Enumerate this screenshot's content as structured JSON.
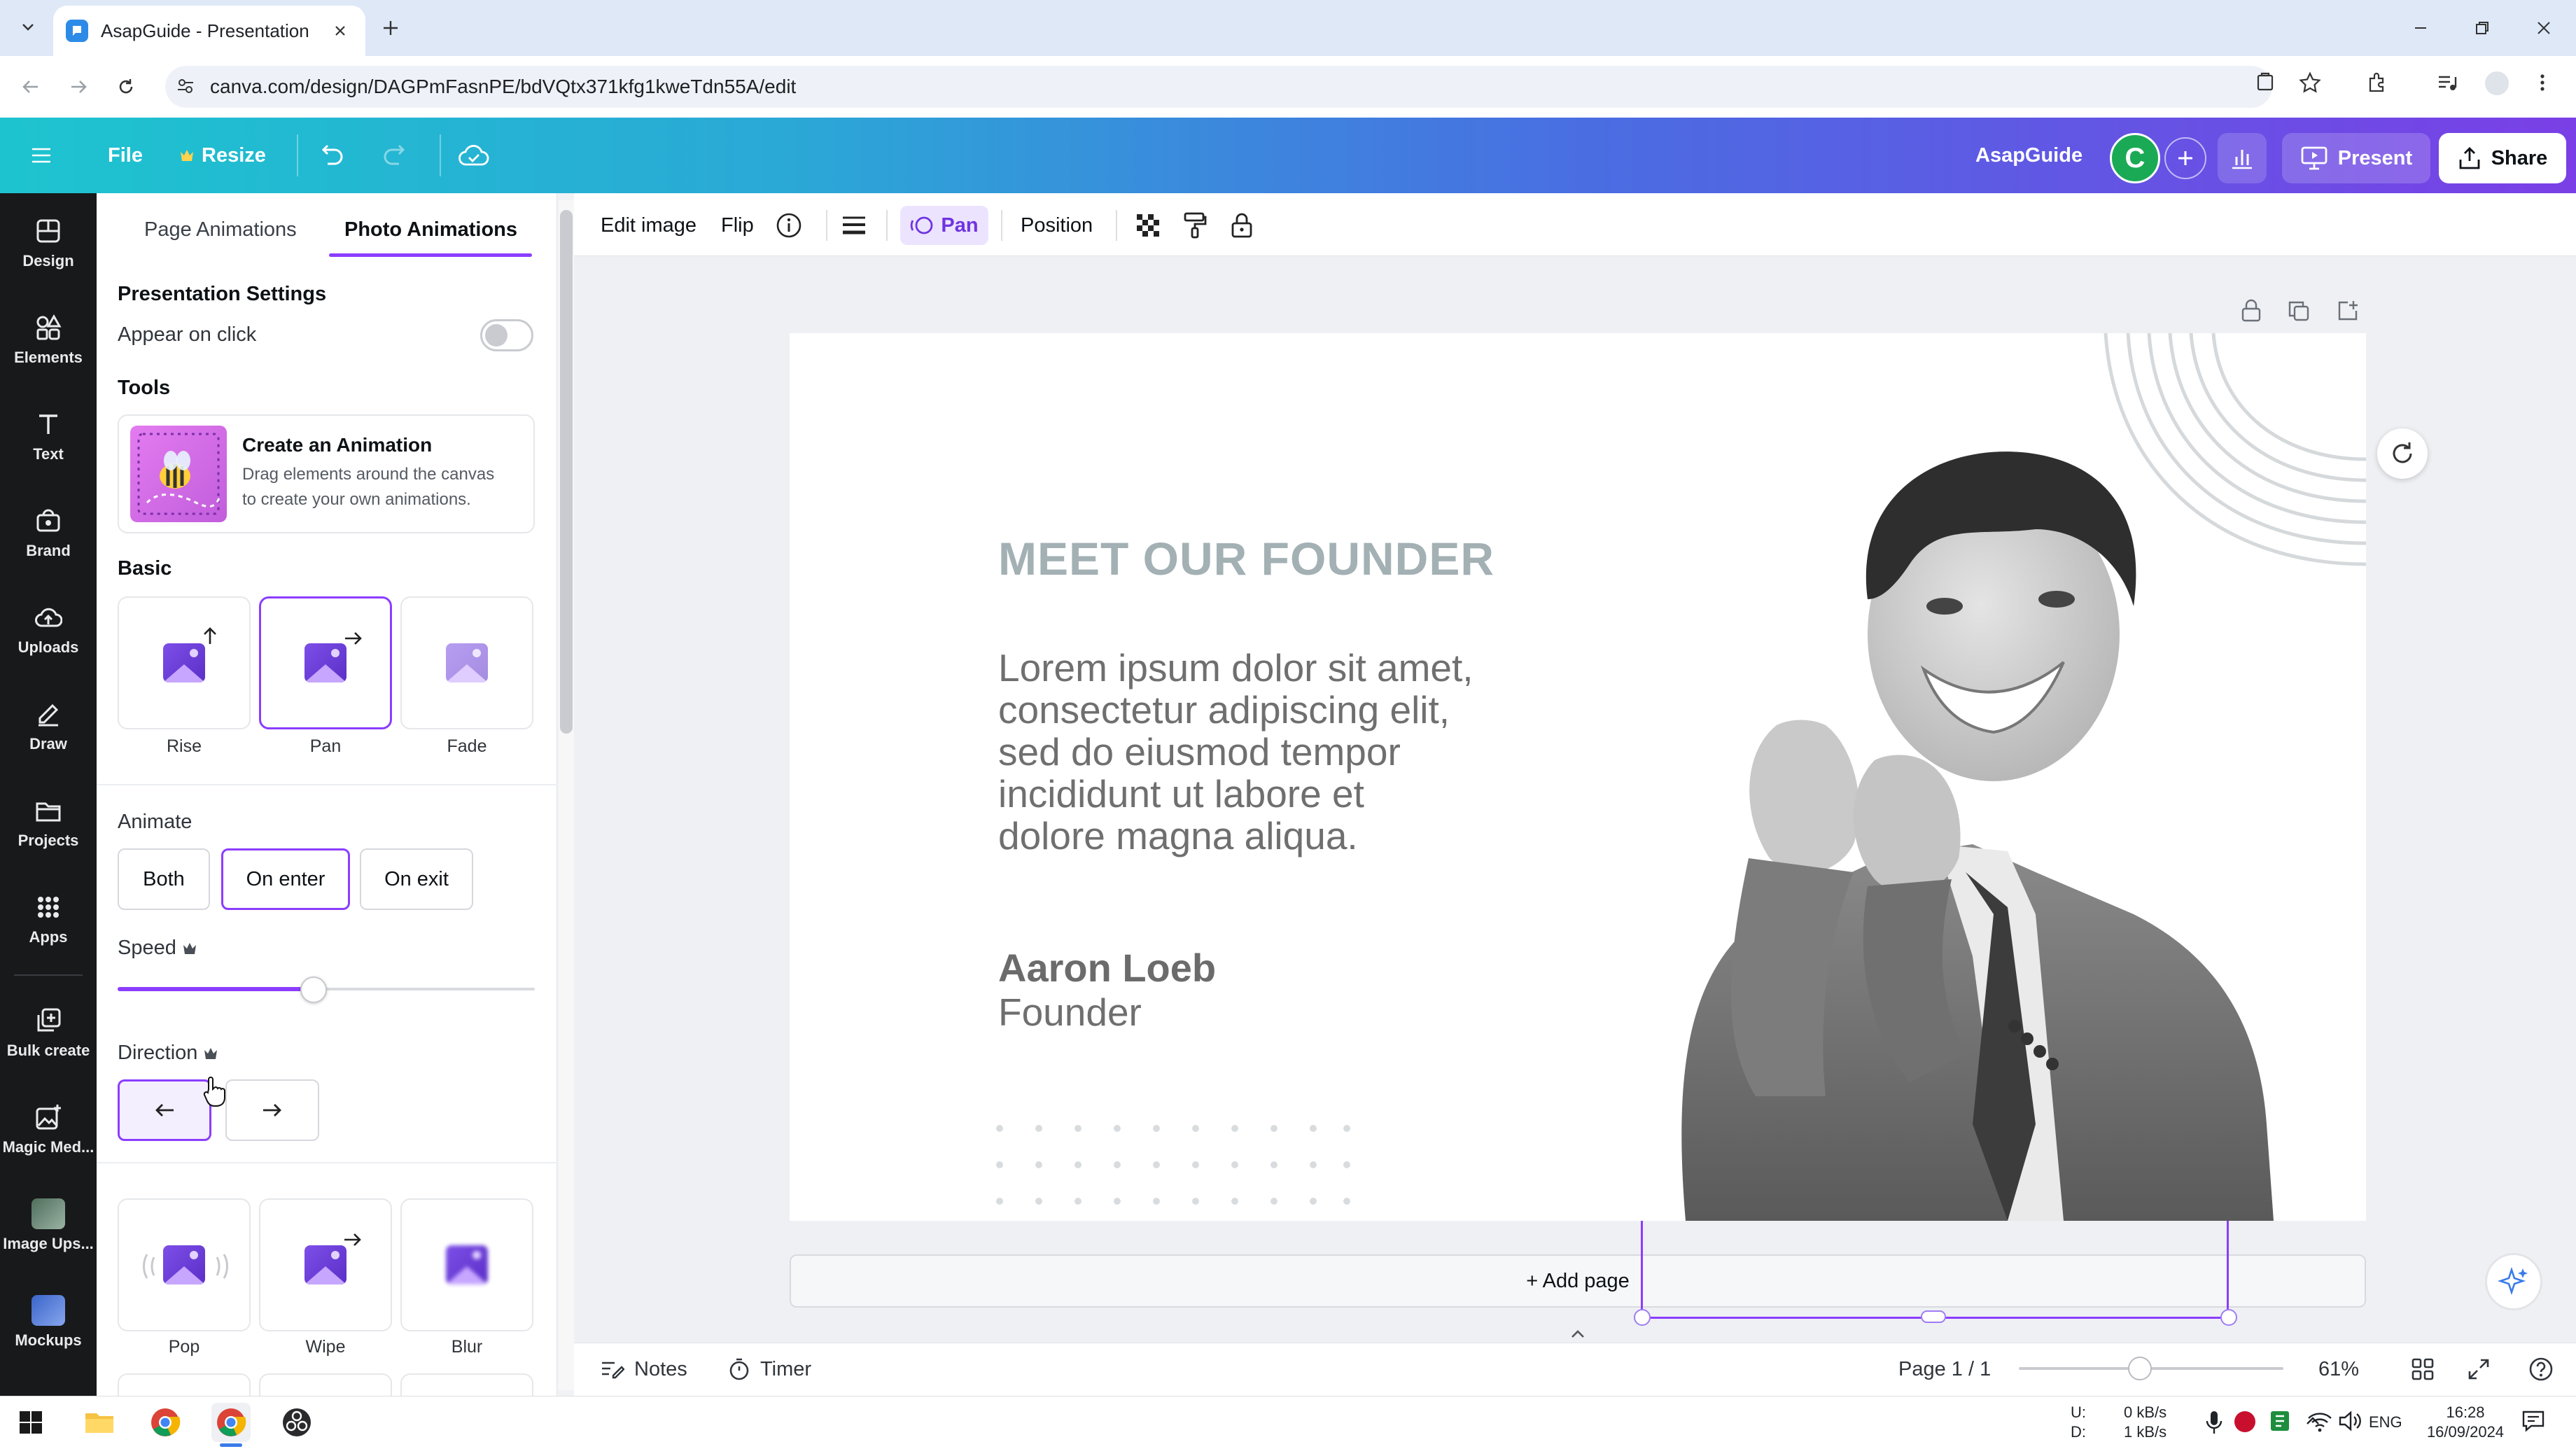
{
  "browser": {
    "tab_title": "AsapGuide - Presentation",
    "url": "canva.com/design/DAGPmFasnPE/bdVQtx371kfg1kweTdn55A/edit"
  },
  "header": {
    "file_label": "File",
    "resize_label": "Resize",
    "brand_name": "AsapGuide",
    "avatar_initial": "C",
    "present_label": "Present",
    "share_label": "Share"
  },
  "rail": {
    "items": [
      {
        "label": "Design"
      },
      {
        "label": "Elements"
      },
      {
        "label": "Text"
      },
      {
        "label": "Brand"
      },
      {
        "label": "Uploads"
      },
      {
        "label": "Draw"
      },
      {
        "label": "Projects"
      },
      {
        "label": "Apps"
      },
      {
        "label": "Bulk create"
      },
      {
        "label": "Magic Med..."
      },
      {
        "label": "Image Ups..."
      },
      {
        "label": "Mockups"
      }
    ]
  },
  "panel": {
    "tabs": [
      "Page Animations",
      "Photo Animations"
    ],
    "active_tab": "Photo Animations",
    "presentation_settings": "Presentation Settings",
    "appear_on_click": "Appear on click",
    "appear_on_click_enabled": false,
    "tools": "Tools",
    "tool_card": {
      "title": "Create an Animation",
      "desc_line1": "Drag elements around the canvas",
      "desc_line2": "to create your own animations."
    },
    "basic": "Basic",
    "basic_animations": [
      "Rise",
      "Pan",
      "Fade"
    ],
    "selected_animation": "Pan",
    "animate_label": "Animate",
    "animate_options": [
      "Both",
      "On enter",
      "On exit"
    ],
    "animate_selected": "On enter",
    "speed_label": "Speed",
    "speed_value": 0.47,
    "direction_label": "Direction",
    "direction_selected": "left",
    "more_animations": [
      "Pop",
      "Wipe",
      "Blur"
    ]
  },
  "context_toolbar": {
    "edit_image": "Edit image",
    "flip": "Flip",
    "pan": "Pan",
    "position": "Position"
  },
  "slide": {
    "title": "MEET OUR FOUNDER",
    "body_lines": [
      "Lorem ipsum dolor sit amet,",
      "consectetur adipiscing elit,",
      "sed do eiusmod tempor",
      "incididunt ut labore et",
      "dolore magna aliqua."
    ],
    "name": "Aaron Loeb",
    "role": "Founder"
  },
  "canvas": {
    "add_page": "+ Add page"
  },
  "footer": {
    "notes": "Notes",
    "timer": "Timer",
    "page_indicator": "Page 1 / 1",
    "zoom": "61%"
  },
  "taskbar": {
    "net_up_label": "U:",
    "net_down_label": "D:",
    "net_up": "0 kB/s",
    "net_down": "1 kB/s",
    "language": "ENG",
    "time": "16:28",
    "date": "16/09/2024"
  },
  "colors": {
    "accent": "#8b3dff",
    "header_gradient_start": "#1dc4cf",
    "header_gradient_end": "#7a3fe6",
    "slide_title": "#a3b0b4",
    "avatar": "#1aaa55"
  }
}
